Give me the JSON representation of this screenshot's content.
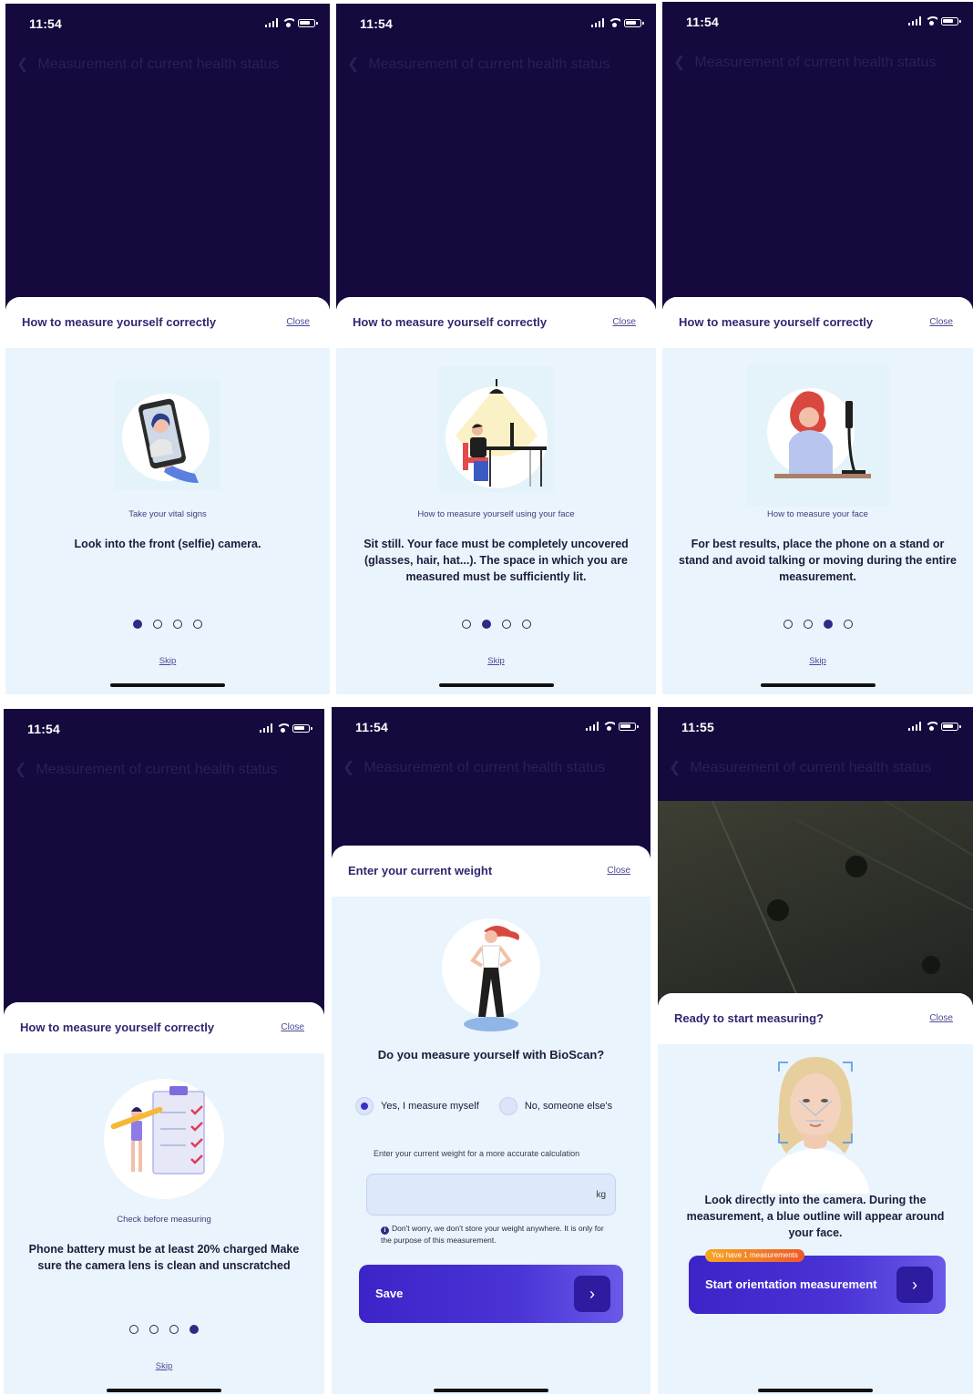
{
  "common": {
    "nav_title": "Measurement of current health status",
    "onboarding_title": "How to measure yourself correctly",
    "close_label": "Close",
    "skip_label": "Skip"
  },
  "screens": [
    {
      "time": "11:54",
      "caption": "Take your vital signs",
      "description": "Look into the front (selfie) camera.",
      "active_dot": 1
    },
    {
      "time": "11:54",
      "caption": "How to measure yourself using your face",
      "description": "Sit still. Your face must be completely uncovered (glasses, hair, hat...). The space in which you are measured must be sufficiently lit.",
      "active_dot": 2
    },
    {
      "time": "11:54",
      "caption": "How to measure your face",
      "description": "For best results, place the phone on a stand or stand and avoid talking or moving during the entire measurement.",
      "active_dot": 3
    },
    {
      "time": "11:54",
      "caption": "Check before measuring",
      "description": "Phone battery must be at least 20% charged Make sure the camera lens is clean and unscratched",
      "active_dot": 4
    }
  ],
  "weight_screen": {
    "time": "11:54",
    "title": "Enter your current weight",
    "question": "Do you measure yourself with BioScan?",
    "option_yes": "Yes, I measure myself",
    "option_no": "No, someone else's",
    "selected": "yes",
    "hint": "Enter your current weight for a more accurate calculation",
    "weight_value": "",
    "unit": "kg",
    "note": "Don't worry, we don't store your weight anywhere. It is only for the purpose of this measurement.",
    "save_label": "Save"
  },
  "ready_screen": {
    "time": "11:55",
    "title": "Ready to start measuring?",
    "description": "Look directly into the camera. During the measurement, a blue outline will appear around your face.",
    "badge": "You have 1 measurements",
    "start_label": "Start orientation measurement"
  },
  "colors": {
    "header_dark": "#15093d",
    "sheet_bg": "#eaf4fd",
    "primary": "#3c24c8",
    "title_text": "#2e2870",
    "badge_orange": "#ef5a2a"
  }
}
